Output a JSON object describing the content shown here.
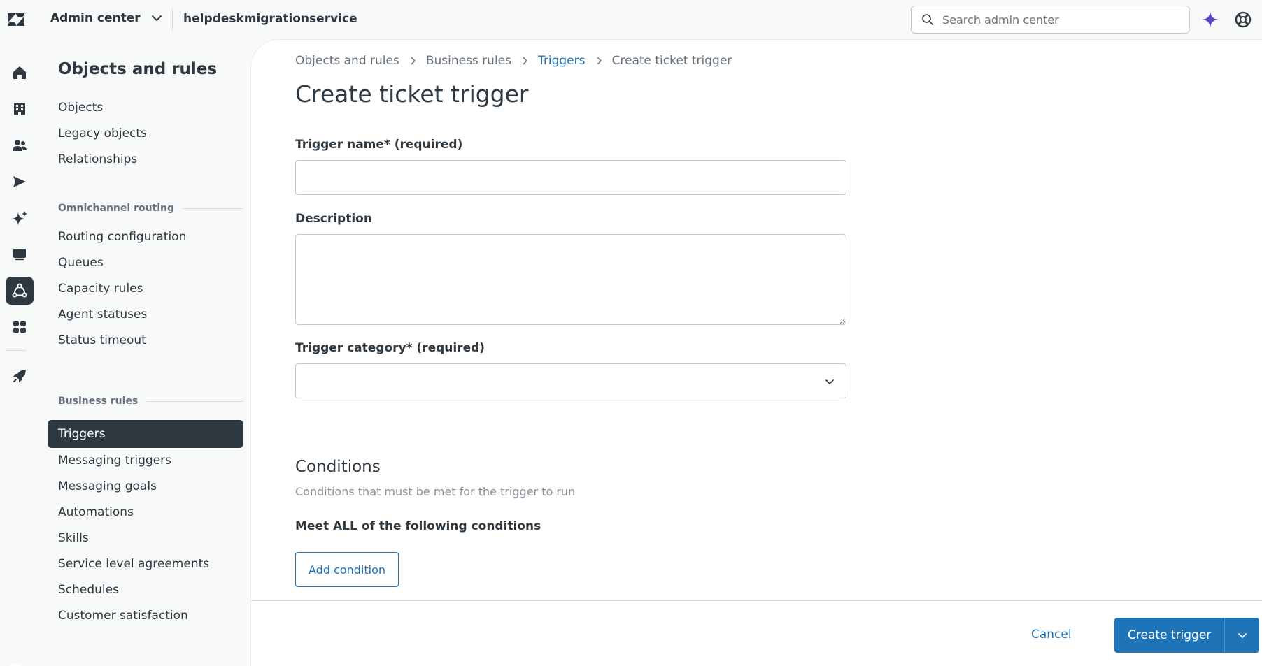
{
  "topbar": {
    "product_name": "Admin center",
    "subdomain": "helpdeskmigrationservice",
    "search_placeholder": "Search admin center"
  },
  "rail": {
    "items": [
      {
        "icon": "home-icon"
      },
      {
        "icon": "building-icon"
      },
      {
        "icon": "people-icon"
      },
      {
        "icon": "send-icon"
      },
      {
        "icon": "sparkle-icon"
      },
      {
        "icon": "chat-icon"
      },
      {
        "icon": "objects-rules-icon",
        "active": true
      },
      {
        "icon": "apps-icon"
      },
      {
        "icon": "rocket-icon"
      }
    ]
  },
  "subnav": {
    "title": "Objects and rules",
    "items_top": [
      "Objects",
      "Legacy objects",
      "Relationships"
    ],
    "section_omnichannel": "Omnichannel routing",
    "items_omnichannel": [
      "Routing configuration",
      "Queues",
      "Capacity rules",
      "Agent statuses",
      "Status timeout"
    ],
    "section_business": "Business rules",
    "items_business": [
      "Triggers",
      "Messaging triggers",
      "Messaging goals",
      "Automations",
      "Skills",
      "Service level agreements",
      "Schedules",
      "Customer satisfaction"
    ],
    "active_item": "Triggers"
  },
  "breadcrumb": {
    "items": [
      "Objects and rules",
      "Business rules",
      "Triggers",
      "Create ticket trigger"
    ]
  },
  "form": {
    "title": "Create ticket trigger",
    "name_label": "Trigger name* (required)",
    "name_value": "",
    "description_label": "Description",
    "description_value": "",
    "category_label": "Trigger category* (required)",
    "category_value": "",
    "conditions_title": "Conditions",
    "conditions_desc": "Conditions that must be met for the trigger to run",
    "meet_all_label": "Meet ALL of the following conditions",
    "add_condition_label": "Add condition"
  },
  "footer": {
    "cancel_label": "Cancel",
    "create_label": "Create trigger"
  },
  "colors": {
    "brand_blue": "#1f73b7",
    "nav_active_bg": "#2f3941",
    "ai_purple": "#5c46c2"
  }
}
